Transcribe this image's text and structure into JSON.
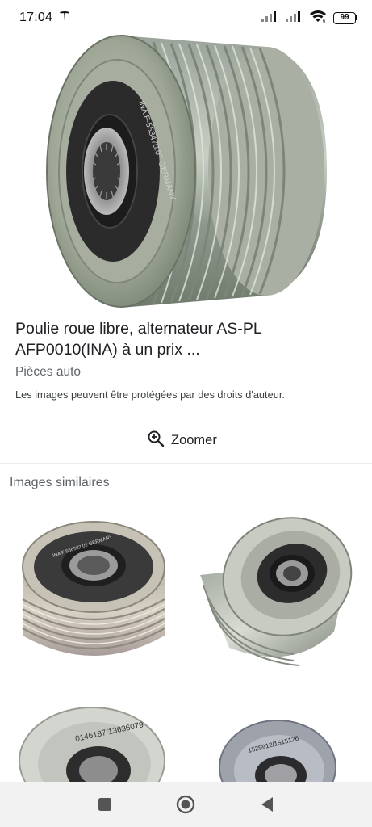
{
  "status_bar": {
    "time": "17:04",
    "battery": "99",
    "icons": [
      "tesla-notification-icon",
      "signal-icon",
      "signal-icon",
      "wifi-icon",
      "battery-icon"
    ]
  },
  "hero": {
    "icon": "pulley-image",
    "engraving": "INA F-553470.07 GERMANY"
  },
  "result": {
    "title": "Poulie roue libre, alternateur AS-PL AFP0010(INA) à un prix ...",
    "source": "Pièces auto",
    "copyright": "Les images peuvent être protégées par des droits d'auteur."
  },
  "zoom": {
    "label": "Zoomer",
    "icon": "zoom-in-icon"
  },
  "similar": {
    "heading": "Images similaires",
    "thumb_engravings": [
      "INA F-556532.02 GERMANY",
      "",
      "0146187/13636079",
      "1529912/1515126"
    ]
  },
  "nav": {
    "icons": [
      "recents-square-icon",
      "home-circle-icon",
      "back-triangle-icon"
    ]
  },
  "colors": {
    "background": "#ffffff",
    "text": "#202124",
    "secondary_text": "#5f6368",
    "nav_bar": "#f2f2f2"
  }
}
